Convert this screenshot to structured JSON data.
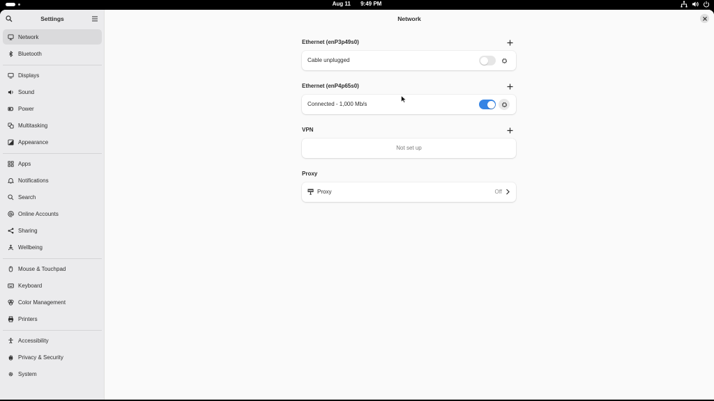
{
  "topbar": {
    "date": "Aug 11",
    "time": "9:49 PM",
    "tray_icons": [
      "network-icon",
      "volume-icon",
      "power-icon"
    ]
  },
  "sidebar": {
    "title": "Settings",
    "search_icon": "search-icon",
    "menu_icon": "hamburger-menu-icon",
    "items": [
      {
        "label": "Network",
        "icon": "network-icon",
        "active": true
      },
      {
        "label": "Bluetooth",
        "icon": "bluetooth-icon"
      },
      {
        "label": "Displays",
        "icon": "display-icon"
      },
      {
        "label": "Sound",
        "icon": "speaker-icon"
      },
      {
        "label": "Power",
        "icon": "battery-icon"
      },
      {
        "label": "Multitasking",
        "icon": "multitasking-icon"
      },
      {
        "label": "Appearance",
        "icon": "appearance-icon"
      },
      {
        "label": "Apps",
        "icon": "apps-grid-icon"
      },
      {
        "label": "Notifications",
        "icon": "bell-icon"
      },
      {
        "label": "Search",
        "icon": "search-icon"
      },
      {
        "label": "Online Accounts",
        "icon": "at-icon"
      },
      {
        "label": "Sharing",
        "icon": "share-icon"
      },
      {
        "label": "Wellbeing",
        "icon": "wellbeing-icon"
      },
      {
        "label": "Mouse & Touchpad",
        "icon": "mouse-icon"
      },
      {
        "label": "Keyboard",
        "icon": "keyboard-icon"
      },
      {
        "label": "Color Management",
        "icon": "palette-icon"
      },
      {
        "label": "Printers",
        "icon": "printer-icon"
      },
      {
        "label": "Accessibility",
        "icon": "accessibility-icon"
      },
      {
        "label": "Privacy & Security",
        "icon": "hand-icon"
      },
      {
        "label": "System",
        "icon": "gear-icon"
      }
    ]
  },
  "main": {
    "title": "Network",
    "ethernet1": {
      "title": "Ethernet (enP3p49s0)",
      "status": "Cable unplugged",
      "enabled": false
    },
    "ethernet2": {
      "title": "Ethernet (enP4p65s0)",
      "status": "Connected - 1,000 Mb/s",
      "enabled": true
    },
    "vpn": {
      "title": "VPN",
      "empty_text": "Not set up"
    },
    "proxy": {
      "title": "Proxy",
      "row_label": "Proxy",
      "row_value": "Off"
    }
  },
  "colors": {
    "accent": "#3584e4",
    "sidebar_bg": "#ebebed",
    "content_bg": "#fafafa"
  }
}
